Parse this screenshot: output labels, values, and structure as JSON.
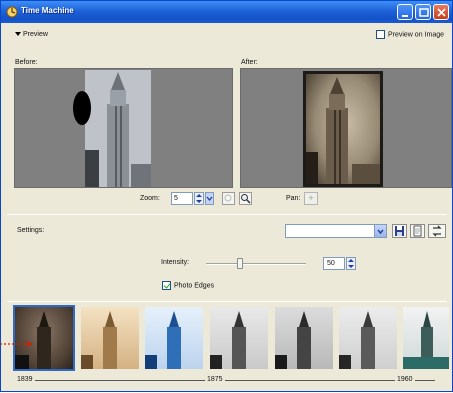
{
  "window": {
    "title": "Time Machine"
  },
  "preview_section": {
    "toggle_label": "Preview",
    "preview_on_image_label": "Preview on Image",
    "preview_on_image_checked": false
  },
  "panes": {
    "before_label": "Before:",
    "after_label": "After:"
  },
  "zoom": {
    "label": "Zoom:",
    "value": "5",
    "pan_label": "Pan:"
  },
  "settings": {
    "label": "Settings:",
    "selected_value": ""
  },
  "intensity": {
    "label": "Intensity:",
    "value": "50",
    "level_percent": 30
  },
  "photo_edges": {
    "label": "Photo Edges",
    "checked": true
  },
  "thumbnails": [
    {
      "name": "sepia-dark",
      "selected": true
    },
    {
      "name": "sepia-warm",
      "selected": false
    },
    {
      "name": "blue-cyanotype",
      "selected": false
    },
    {
      "name": "grayscale-1",
      "selected": false
    },
    {
      "name": "grayscale-2",
      "selected": false
    },
    {
      "name": "grayscale-3",
      "selected": false
    },
    {
      "name": "teal-tint",
      "selected": false
    }
  ],
  "timeline": {
    "years": [
      "1839",
      "1875",
      "1960"
    ]
  },
  "colors": {
    "titlebar": "#1f62d8",
    "window_bg": "#ece9d8",
    "callout": "#cc2200"
  }
}
